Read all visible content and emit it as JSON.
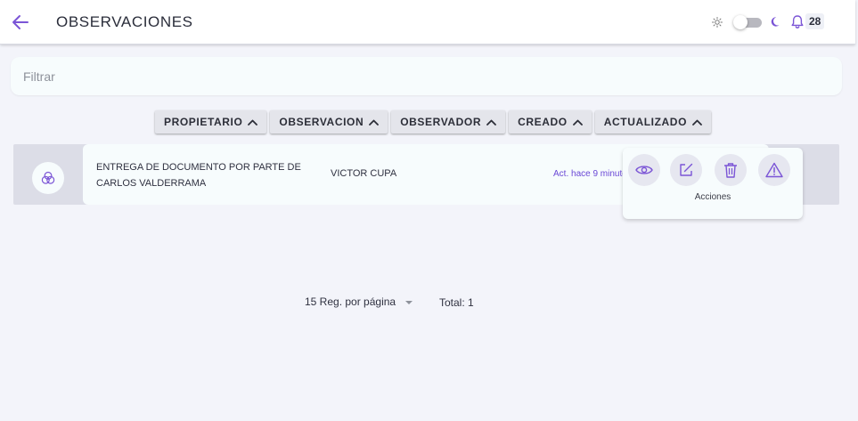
{
  "header": {
    "title": "OBSERVACIONES",
    "notification_count": "28"
  },
  "filter": {
    "placeholder": "Filtrar",
    "value": ""
  },
  "sort_columns": [
    {
      "label": "PROPIETARIO"
    },
    {
      "label": "OBSERVACION"
    },
    {
      "label": "OBSERVADOR"
    },
    {
      "label": "CREADO"
    },
    {
      "label": "ACTUALIZADO"
    }
  ],
  "rows": [
    {
      "observation": "ENTREGA DE DOCUMENTO POR PARTE DE CARLOS VALDERRAMA",
      "observer": "VICTOR CUPA",
      "updated": "Act. hace 9 minutos"
    }
  ],
  "actions": {
    "label": "Acciones"
  },
  "pagination": {
    "per_page": "15 Reg. por página",
    "total": "Total: 1"
  },
  "colors": {
    "accent": "#7b55d6",
    "background": "#f3f4fa",
    "card": "#f7fcfd"
  }
}
